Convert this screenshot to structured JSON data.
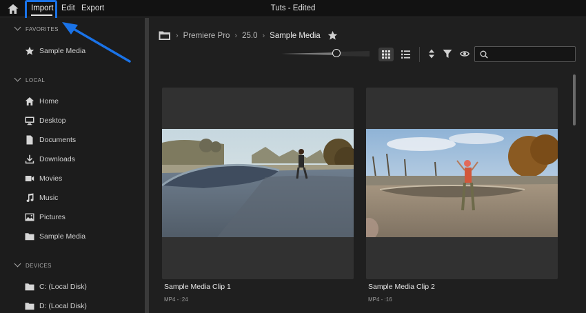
{
  "window": {
    "title": "Tuts - Edited"
  },
  "menu": {
    "import": "Import",
    "edit": "Edit",
    "export": "Export"
  },
  "sidebar": {
    "favorites_header": "FAVORITES",
    "favorites": [
      {
        "label": "Sample Media",
        "icon": "star-icon"
      }
    ],
    "local_header": "LOCAL",
    "local": [
      {
        "label": "Home",
        "icon": "home-icon"
      },
      {
        "label": "Desktop",
        "icon": "monitor-icon"
      },
      {
        "label": "Documents",
        "icon": "document-icon"
      },
      {
        "label": "Downloads",
        "icon": "download-icon"
      },
      {
        "label": "Movies",
        "icon": "video-camera-icon"
      },
      {
        "label": "Music",
        "icon": "music-note-icon"
      },
      {
        "label": "Pictures",
        "icon": "image-icon"
      },
      {
        "label": "Sample Media",
        "icon": "folder-icon"
      }
    ],
    "devices_header": "DEVICES",
    "devices": [
      {
        "label": "C: (Local Disk)",
        "icon": "folder-icon"
      },
      {
        "label": "D: (Local Disk)",
        "icon": "folder-icon"
      }
    ]
  },
  "breadcrumb": {
    "items": [
      "Premiere Pro",
      "25.0",
      "Sample Media"
    ]
  },
  "search": {
    "placeholder": ""
  },
  "clips": [
    {
      "title": "Sample Media Clip 1",
      "meta": "MP4 - :24"
    },
    {
      "title": "Sample Media Clip 2",
      "meta": "MP4 - :16"
    }
  ],
  "colors": {
    "accent": "#1a73e8",
    "background": "#1f1f1f",
    "card": "#313131"
  }
}
